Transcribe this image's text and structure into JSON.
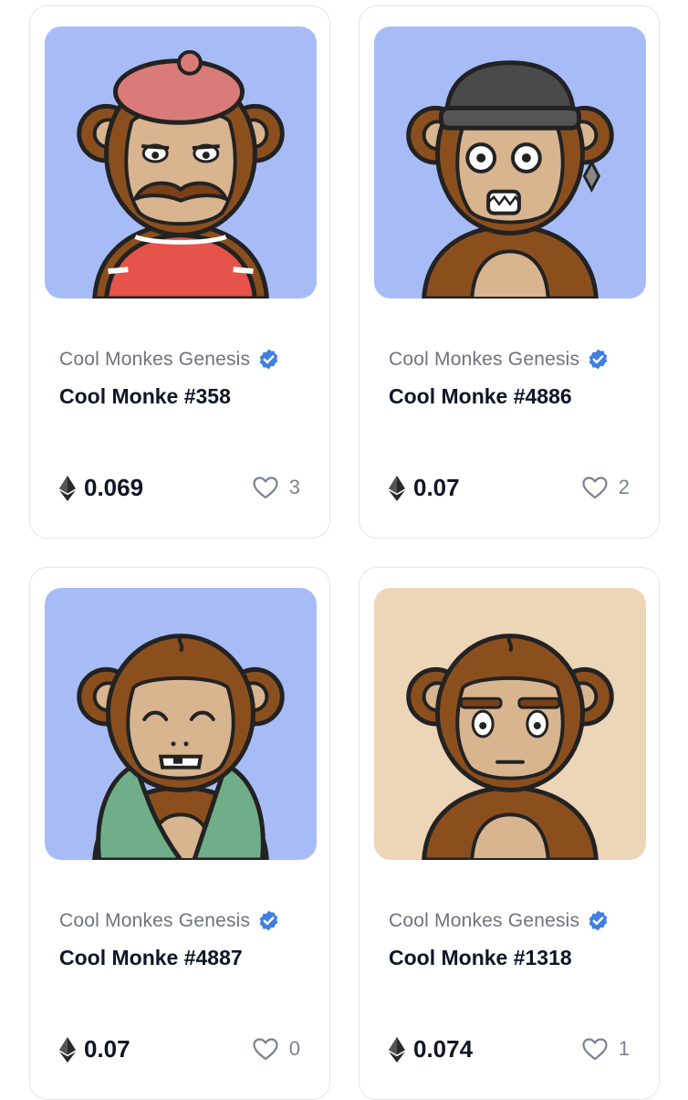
{
  "colors": {
    "card_border": "#e3e5ea",
    "verified_blue": "#3f7fe0",
    "title_text": "#0f1525",
    "muted_text": "#6e7380",
    "bg_blue": "#a7bcf7",
    "bg_beige": "#ecd6b7"
  },
  "items": [
    {
      "collection": "Cool Monkes Genesis",
      "name": "Cool Monke #358",
      "price": "0.069",
      "likes": "3",
      "background": "#a7bcf7",
      "icon": "monke-beret-mustache-image"
    },
    {
      "collection": "Cool Monkes Genesis",
      "name": "Cool Monke #4886",
      "price": "0.07",
      "likes": "2",
      "background": "#a7bcf7",
      "icon": "monke-beanie-earring-image"
    },
    {
      "collection": "Cool Monkes Genesis",
      "name": "Cool Monke #4887",
      "price": "0.07",
      "likes": "0",
      "background": "#a7bcf7",
      "icon": "monke-fur-coat-image"
    },
    {
      "collection": "Cool Monkes Genesis",
      "name": "Cool Monke #1318",
      "price": "0.074",
      "likes": "1",
      "background": "#ecd6b7",
      "icon": "monke-plain-image"
    }
  ]
}
